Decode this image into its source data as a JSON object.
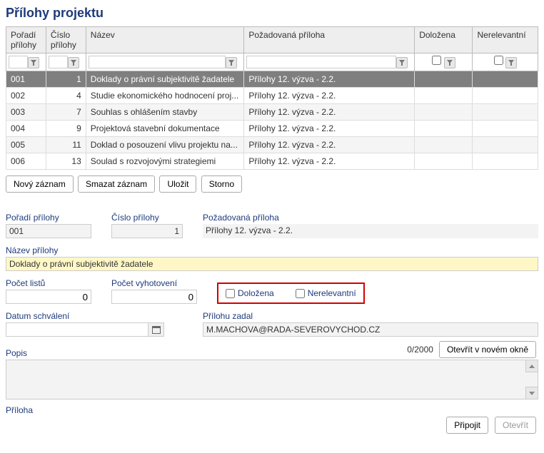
{
  "title": "Přílohy projektu",
  "columns": {
    "poradi": "Pořadí přílohy",
    "cislo": "Číslo přílohy",
    "nazev": "Název",
    "pozadovana": "Požadovaná příloha",
    "dolozena": "Doložena",
    "nerelevantni": "Nerelevantní"
  },
  "rows": [
    {
      "poradi": "001",
      "cislo": "1",
      "nazev": "Doklady o právní subjektivitě žadatele",
      "pozad": "Přílohy 12. výzva - 2.2."
    },
    {
      "poradi": "002",
      "cislo": "4",
      "nazev": "Studie ekonomického hodnocení proj...",
      "pozad": "Přílohy 12. výzva - 2.2."
    },
    {
      "poradi": "003",
      "cislo": "7",
      "nazev": "Souhlas s ohlášením stavby",
      "pozad": "Přílohy 12. výzva - 2.2."
    },
    {
      "poradi": "004",
      "cislo": "9",
      "nazev": "Projektová stavební dokumentace",
      "pozad": "Přílohy 12. výzva - 2.2."
    },
    {
      "poradi": "005",
      "cislo": "11",
      "nazev": "Doklad o posouzení vlivu projektu na...",
      "pozad": "Přílohy 12. výzva - 2.2."
    },
    {
      "poradi": "006",
      "cislo": "13",
      "nazev": "Soulad s rozvojovými strategiemi",
      "pozad": "Přílohy 12. výzva - 2.2."
    }
  ],
  "buttons": {
    "novy": "Nový záznam",
    "smazat": "Smazat záznam",
    "ulozit": "Uložit",
    "storno": "Storno",
    "otevrit_nove": "Otevřít v novém okně",
    "pripojit": "Připojit",
    "otevrit": "Otevřít"
  },
  "form": {
    "poradi_label": "Pořadí přílohy",
    "poradi_val": "001",
    "cislo_label": "Číslo přílohy",
    "cislo_val": "1",
    "pozad_label": "Požadovaná příloha",
    "pozad_val": "Přílohy 12. výzva - 2.2.",
    "nazev_label": "Název přílohy",
    "nazev_val": "Doklady o právní subjektivitě žadatele",
    "pocet_listu_label": "Počet listů",
    "pocet_listu_val": "0",
    "pocet_vyhot_label": "Počet vyhotovení",
    "pocet_vyhot_val": "0",
    "dolozena_label": "Doložena",
    "nerelevantni_label": "Nerelevantní",
    "datum_label": "Datum schválení",
    "datum_val": "",
    "zadal_label": "Přílohu zadal",
    "zadal_val": "M.MACHOVA@RADA-SEVEROVYCHOD.CZ",
    "popis_label": "Popis",
    "popis_counter": "0/2000",
    "priloha_label": "Příloha"
  }
}
